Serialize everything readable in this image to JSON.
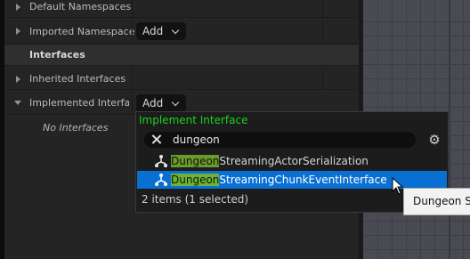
{
  "rows": {
    "default_namespaces": "Default Namespaces",
    "imported_namespaces": "Imported Namespace",
    "interfaces_section": "Interfaces",
    "inherited_interfaces": "Inherited Interfaces",
    "implemented_interfaces": "Implemented Interfac",
    "no_interfaces": "No Interfaces"
  },
  "buttons": {
    "add_imported": "Add",
    "add_implemented": "Add"
  },
  "popup": {
    "title": "Implement Interface",
    "search_value": "dungeon",
    "items": [
      {
        "match": "Dungeon",
        "rest": "StreamingActorSerialization",
        "selected": false
      },
      {
        "match": "Dungeon",
        "rest": "StreamingChunkEventInterface",
        "selected": true
      }
    ],
    "status": "2 items (1 selected)"
  },
  "tooltip": "Dungeon St",
  "colors": {
    "accent_green": "#19d51a",
    "selection_blue": "#0a6fd3",
    "match_highlight": "#6a9a2a"
  },
  "icons": [
    "chevron-right-icon",
    "chevron-down-icon",
    "clear-search-icon",
    "settings-gear-icon",
    "interface-node-icon",
    "mouse-cursor-icon"
  ]
}
